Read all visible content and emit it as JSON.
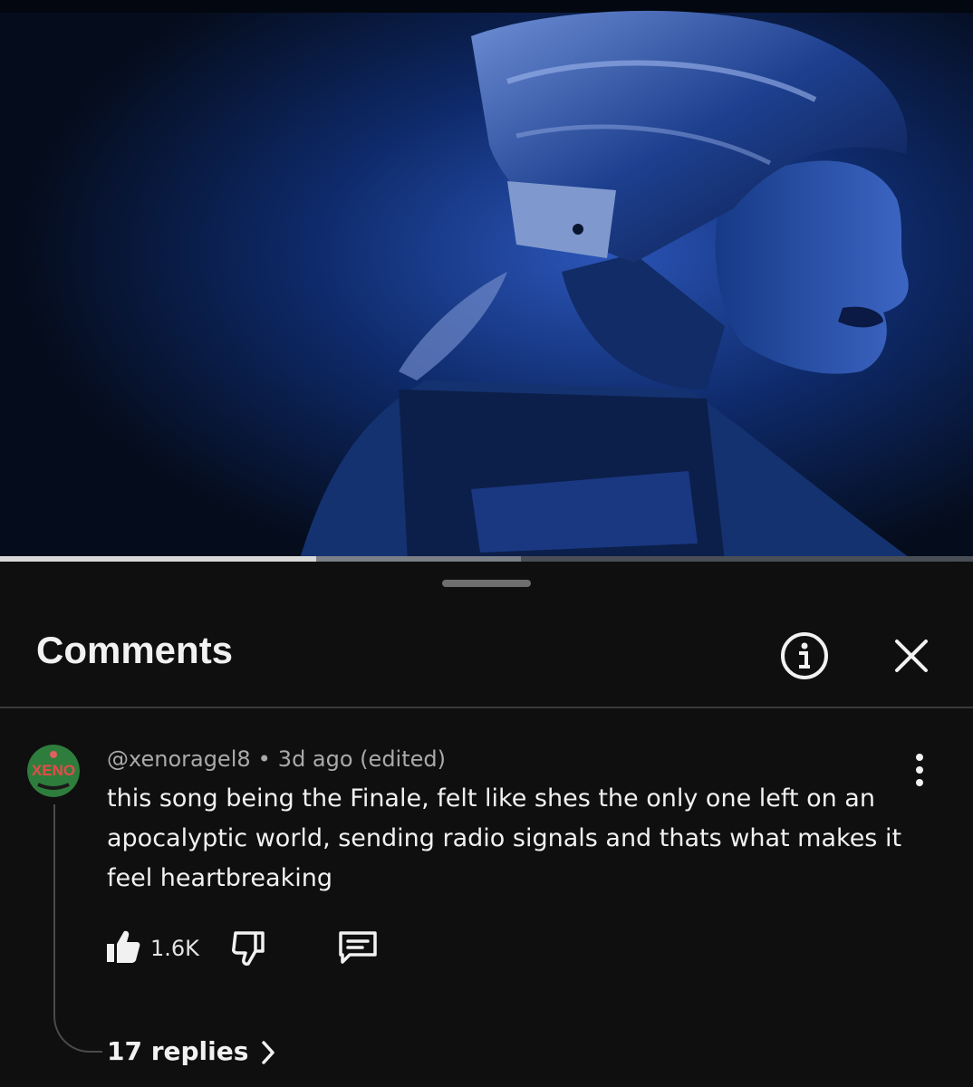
{
  "video": {
    "progress": 0.325,
    "buffered": 0.535
  },
  "sheet": {
    "title": "Comments",
    "info_icon": "info-circle-icon",
    "close_icon": "close-icon"
  },
  "comment": {
    "avatar_text": "XENO",
    "author": "@xenoragel8",
    "separator": "•",
    "time": "3d ago (edited)",
    "text": "this song being the Finale, felt like shes the only one left on an apocalyptic world, sending radio signals and thats what makes it feel heartbreaking",
    "likes": "1.6K",
    "replies_label": "17 replies"
  },
  "colors": {
    "background": "#0f0f0f",
    "text_primary": "#f1f1f1",
    "text_secondary": "#aaaaaa",
    "video_tint": "#0b2a6e"
  }
}
